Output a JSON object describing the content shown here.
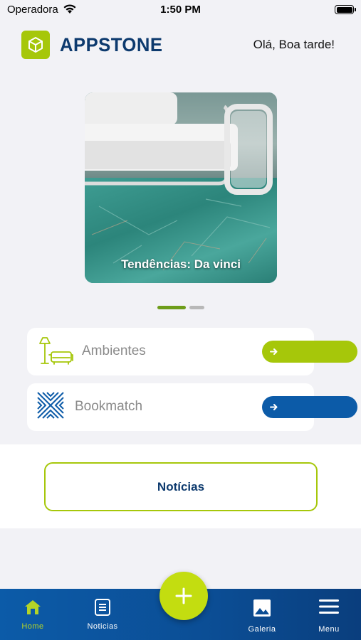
{
  "status_bar": {
    "carrier": "Operadora",
    "time": "1:50 PM"
  },
  "header": {
    "brand": "APPSTONE",
    "greeting": "Olá, Boa tarde!"
  },
  "banner": {
    "caption": "Tendências: Da vinci",
    "slide_count": 2,
    "active_slide": 1
  },
  "cards": [
    {
      "label": "Ambientes",
      "icon": "sofa-lamp-icon",
      "accent": "#a6c70a"
    },
    {
      "label": "Bookmatch",
      "icon": "bookmatch-pattern-icon",
      "accent": "#0c5ba8"
    }
  ],
  "news_button": {
    "label": "Notícias"
  },
  "bottom_nav": {
    "items": [
      {
        "label": "Home",
        "icon": "home-icon",
        "active": true
      },
      {
        "label": "Noticias",
        "icon": "news-icon"
      },
      {
        "label": "Galeria",
        "icon": "gallery-icon"
      },
      {
        "label": "Menu",
        "icon": "hamburger-icon"
      }
    ],
    "fab_icon": "plus-icon"
  },
  "colors": {
    "brand_green": "#a6c70a",
    "brand_blue": "#0c5ba8",
    "brand_navy": "#0d3a6e"
  }
}
